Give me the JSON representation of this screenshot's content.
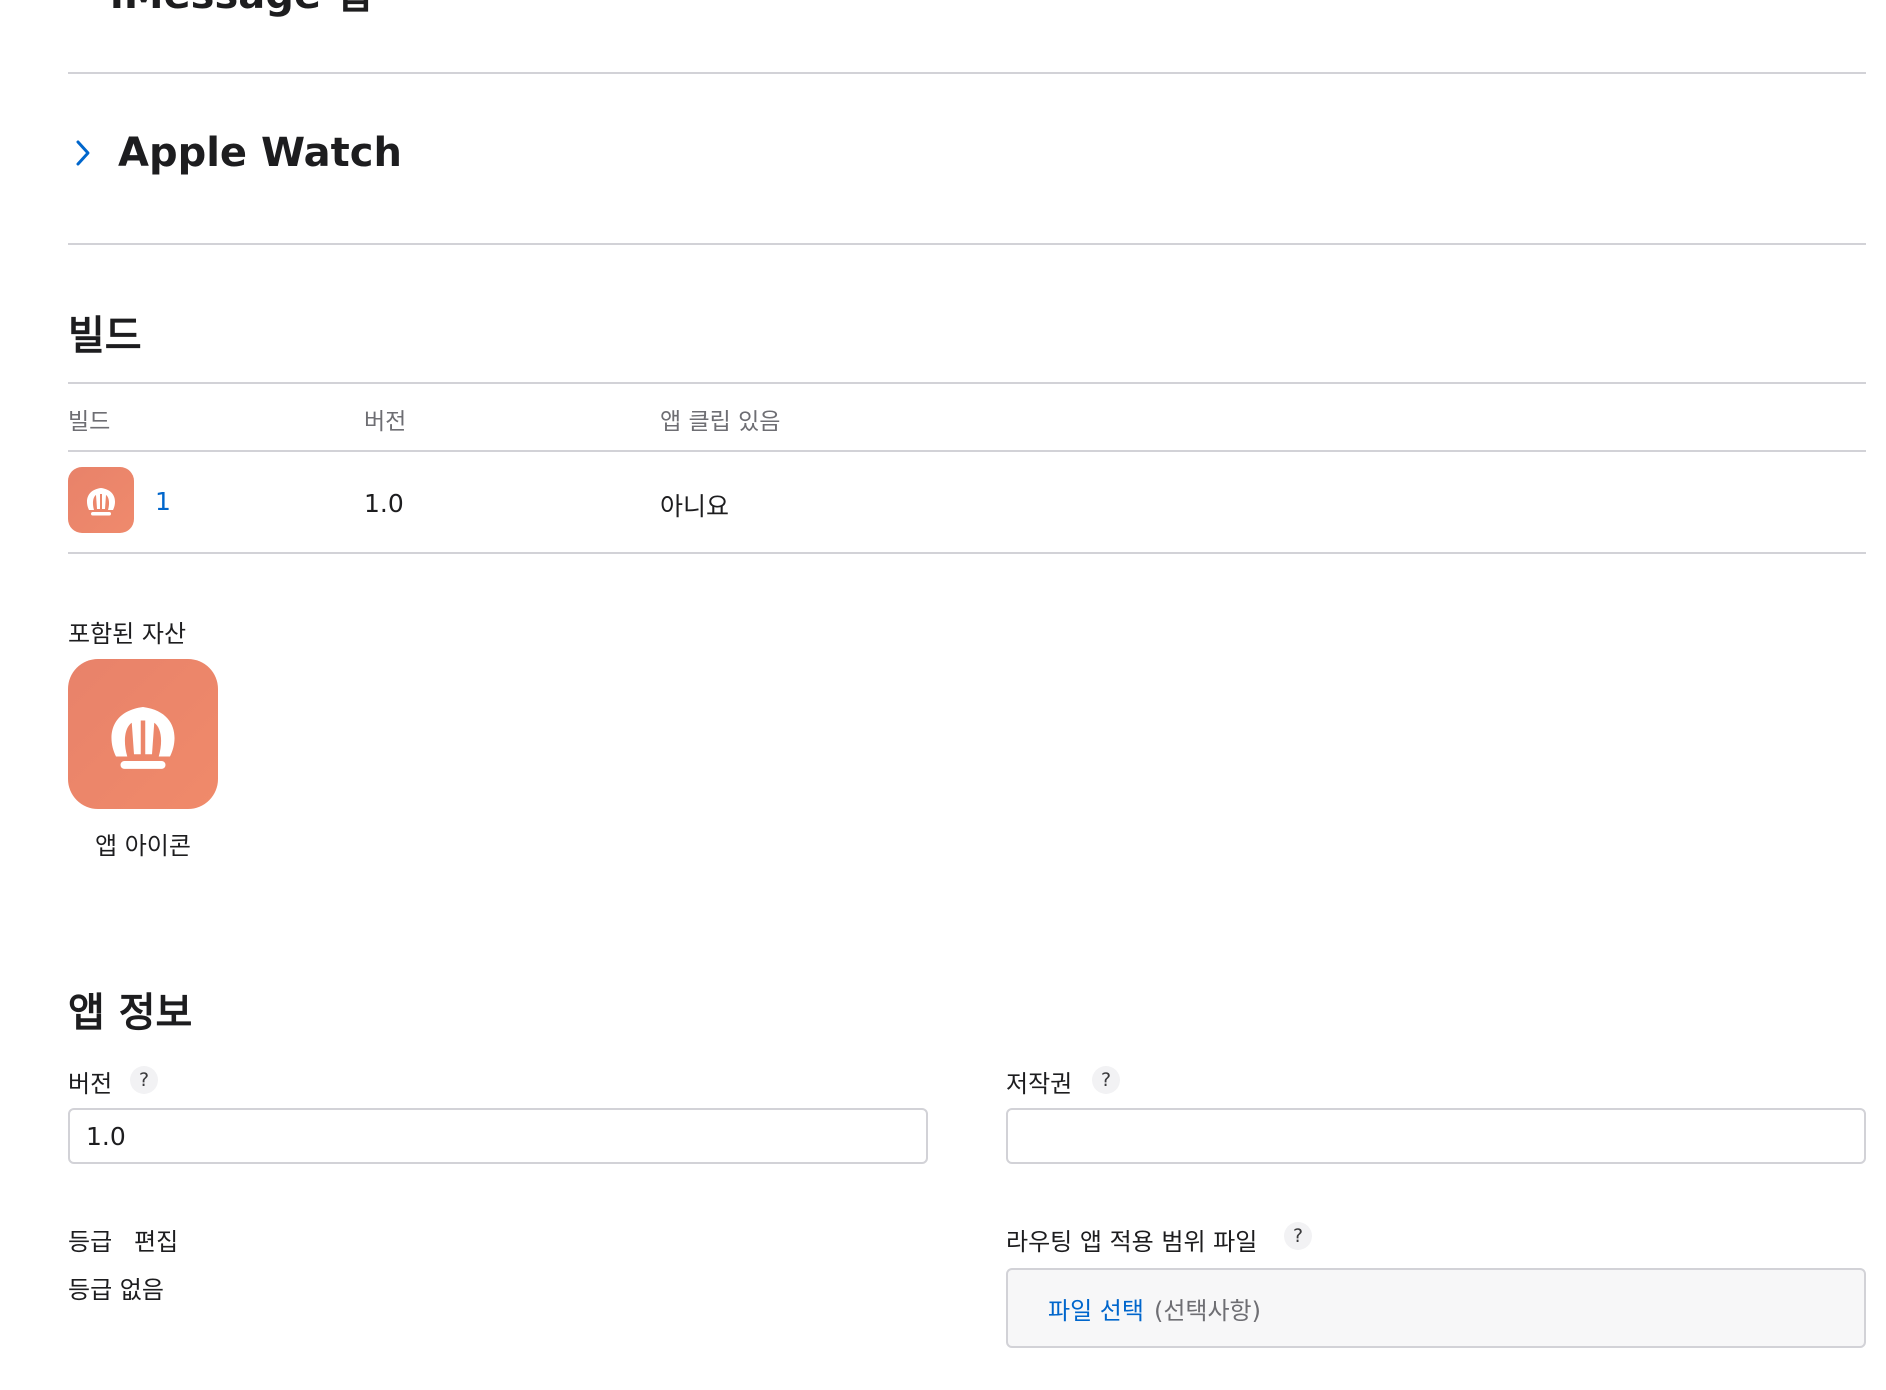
{
  "sections": {
    "top_clipped_title": "iMessage 앱",
    "apple_watch": "Apple Watch"
  },
  "builds": {
    "title": "빌드",
    "columns": {
      "build": "빌드",
      "version": "버전",
      "app_clip": "앱 클립 있음"
    },
    "rows": [
      {
        "build": "1",
        "version": "1.0",
        "app_clip": "아니요"
      }
    ]
  },
  "assets": {
    "title": "포함된 자산",
    "app_icon_label": "앱 아이콘"
  },
  "app_info": {
    "title": "앱 정보",
    "version_label": "버전",
    "version_value": "1.0",
    "copyright_label": "저작권",
    "copyright_value": "",
    "help_glyph": "?",
    "rating_label": "등급",
    "rating_edit": "편집",
    "rating_value": "등급 없음",
    "routing_label": "라우팅 앱 적용 범위 파일",
    "file_choose": "파일 선택",
    "file_optional": "(선택사항)"
  },
  "colors": {
    "accent": "#0066cc",
    "icon_bg": "#ef8a6c",
    "divider": "#d2d2d7"
  }
}
